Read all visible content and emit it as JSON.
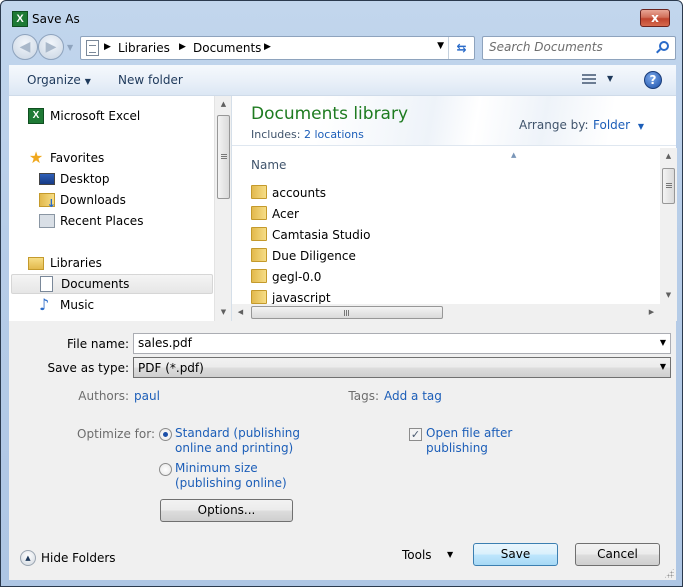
{
  "window": {
    "title": "Save As",
    "app_icon": "excel-icon",
    "close_glyph": "x"
  },
  "navigation": {
    "breadcrumb": [
      "Libraries",
      "Documents"
    ],
    "search_placeholder": "Search Documents"
  },
  "toolbar": {
    "organize_label": "Organize",
    "new_folder_label": "New folder",
    "help_glyph": "?"
  },
  "nav_pane": {
    "items": [
      {
        "label": "Microsoft Excel",
        "icon": "excel-icon"
      },
      {
        "label": "Favorites",
        "icon": "star-icon"
      },
      {
        "label": "Desktop",
        "icon": "desktop-icon"
      },
      {
        "label": "Downloads",
        "icon": "downloads-icon"
      },
      {
        "label": "Recent Places",
        "icon": "recent-places-icon"
      },
      {
        "label": "Libraries",
        "icon": "libraries-icon"
      },
      {
        "label": "Documents",
        "icon": "document-icon",
        "selected": true
      },
      {
        "label": "Music",
        "icon": "music-icon"
      }
    ]
  },
  "library": {
    "title": "Documents library",
    "includes_label": "Includes:",
    "includes_link": "2 locations",
    "arrange_label": "Arrange by:",
    "arrange_value": "Folder",
    "column_name": "Name",
    "files": [
      {
        "name": "accounts",
        "icon": "folder-icon"
      },
      {
        "name": "Acer",
        "icon": "folder-icon"
      },
      {
        "name": "Camtasia Studio",
        "icon": "folder-icon"
      },
      {
        "name": "Due Diligence",
        "icon": "folder-icon"
      },
      {
        "name": "gegl-0.0",
        "icon": "folder-icon"
      },
      {
        "name": "javascript",
        "icon": "folder-icon"
      }
    ]
  },
  "form": {
    "file_name_label": "File name:",
    "file_name_value": "sales.pdf",
    "save_type_label": "Save as type:",
    "save_type_value": "PDF (*.pdf)",
    "authors_label": "Authors:",
    "authors_value": "paul",
    "tags_label": "Tags:",
    "tags_value": "Add a tag",
    "optimize_label": "Optimize for:",
    "optimize_options": [
      {
        "line1": "Standard (publishing",
        "line2": "online and printing)",
        "checked": true
      },
      {
        "line1": "Minimum size",
        "line2": "(publishing online)",
        "checked": false
      }
    ],
    "open_after_line1": "Open file after",
    "open_after_line2": "publishing",
    "open_after_checked": true,
    "options_button": "Options..."
  },
  "footer": {
    "hide_folders_label": "Hide Folders",
    "tools_label": "Tools",
    "save_label": "Save",
    "cancel_label": "Cancel"
  }
}
